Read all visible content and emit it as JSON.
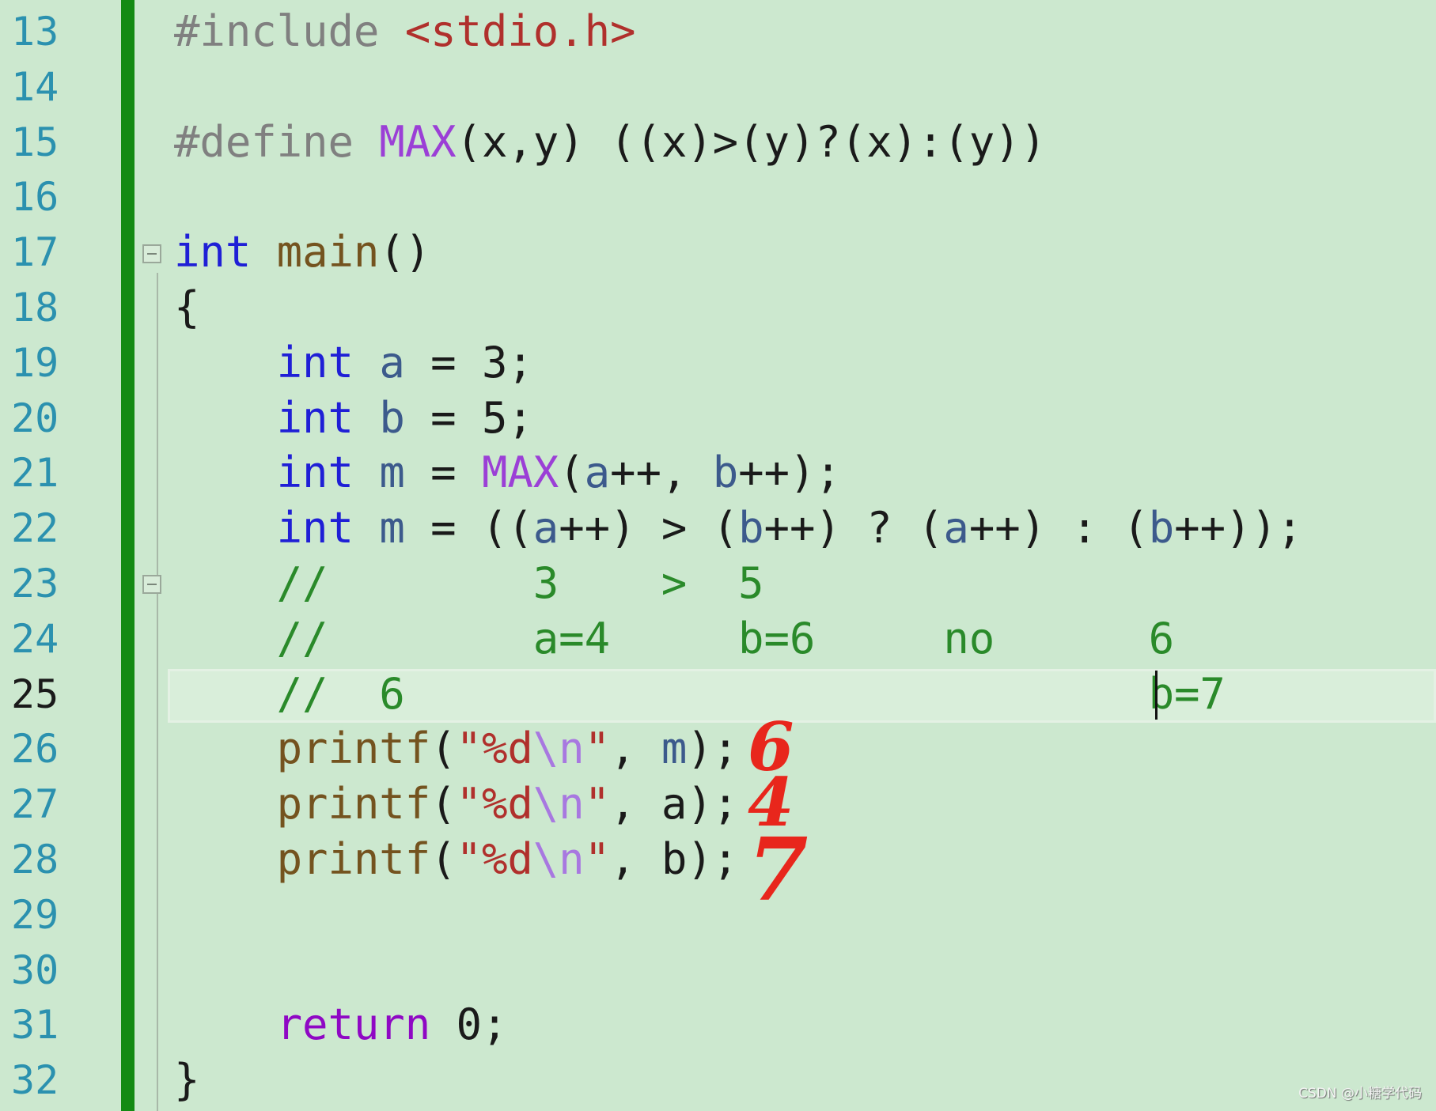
{
  "editor": {
    "current_line": 25,
    "colors": {
      "background": "#cce8cf",
      "line_numbers": "#2b91af",
      "change_bar": "#138a13",
      "keyword": "#1f1fd6",
      "comment": "#2a8a2a",
      "string": "#b0302c",
      "macro": "#9b3fd6"
    },
    "lines": [
      {
        "n": "13",
        "tokens": [
          {
            "t": "#include ",
            "c": "pp"
          },
          {
            "t": "<stdio.h>",
            "c": "str"
          }
        ]
      },
      {
        "n": "14",
        "tokens": []
      },
      {
        "n": "15",
        "tokens": [
          {
            "t": "#define ",
            "c": "pp"
          },
          {
            "t": "MAX",
            "c": "mac"
          },
          {
            "t": "(x,y) ((x)>(y)?(x):(y))",
            "c": "pl"
          }
        ]
      },
      {
        "n": "16",
        "tokens": []
      },
      {
        "n": "17",
        "tokens": [
          {
            "t": "int",
            "c": "kw"
          },
          {
            "t": " ",
            "c": "pl"
          },
          {
            "t": "main",
            "c": "fn"
          },
          {
            "t": "()",
            "c": "pl"
          }
        ]
      },
      {
        "n": "18",
        "tokens": [
          {
            "t": "{",
            "c": "pl"
          }
        ]
      },
      {
        "n": "19",
        "tokens": [
          {
            "t": "    int",
            "c": "kw"
          },
          {
            "t": " ",
            "c": "pl"
          },
          {
            "t": "a",
            "c": "var"
          },
          {
            "t": " = 3;",
            "c": "pl"
          }
        ]
      },
      {
        "n": "20",
        "tokens": [
          {
            "t": "    int",
            "c": "kw"
          },
          {
            "t": " ",
            "c": "pl"
          },
          {
            "t": "b",
            "c": "var"
          },
          {
            "t": " = 5;",
            "c": "pl"
          }
        ]
      },
      {
        "n": "21",
        "tokens": [
          {
            "t": "    int",
            "c": "kw"
          },
          {
            "t": " ",
            "c": "pl"
          },
          {
            "t": "m",
            "c": "var"
          },
          {
            "t": " = ",
            "c": "pl"
          },
          {
            "t": "MAX",
            "c": "mac"
          },
          {
            "t": "(",
            "c": "pl"
          },
          {
            "t": "a",
            "c": "var"
          },
          {
            "t": "++, ",
            "c": "pl"
          },
          {
            "t": "b",
            "c": "var"
          },
          {
            "t": "++);",
            "c": "pl"
          }
        ]
      },
      {
        "n": "22",
        "tokens": [
          {
            "t": "    int",
            "c": "kw"
          },
          {
            "t": " ",
            "c": "pl"
          },
          {
            "t": "m",
            "c": "var"
          },
          {
            "t": " = ((",
            "c": "pl"
          },
          {
            "t": "a",
            "c": "var"
          },
          {
            "t": "++) > (",
            "c": "pl"
          },
          {
            "t": "b",
            "c": "var"
          },
          {
            "t": "++) ? (",
            "c": "pl"
          },
          {
            "t": "a",
            "c": "var"
          },
          {
            "t": "++) : (",
            "c": "pl"
          },
          {
            "t": "b",
            "c": "var"
          },
          {
            "t": "++));",
            "c": "pl"
          }
        ]
      },
      {
        "n": "23",
        "tokens": [
          {
            "t": "    //        3    >  5",
            "c": "cm"
          }
        ]
      },
      {
        "n": "24",
        "tokens": [
          {
            "t": "    //        a=4     b=6     no      6",
            "c": "cm"
          }
        ]
      },
      {
        "n": "25",
        "tokens": [
          {
            "t": "    //  6                             b=7",
            "c": "cm"
          }
        ]
      },
      {
        "n": "26",
        "tokens": [
          {
            "t": "    printf",
            "c": "fn"
          },
          {
            "t": "(",
            "c": "pl"
          },
          {
            "t": "\"%d",
            "c": "str"
          },
          {
            "t": "\\n",
            "c": "esc"
          },
          {
            "t": "\"",
            "c": "str"
          },
          {
            "t": ", ",
            "c": "pl"
          },
          {
            "t": "m",
            "c": "var"
          },
          {
            "t": ");",
            "c": "pl"
          }
        ]
      },
      {
        "n": "27",
        "tokens": [
          {
            "t": "    printf",
            "c": "fn"
          },
          {
            "t": "(",
            "c": "pl"
          },
          {
            "t": "\"%d",
            "c": "str"
          },
          {
            "t": "\\n",
            "c": "esc"
          },
          {
            "t": "\"",
            "c": "str"
          },
          {
            "t": ", a);",
            "c": "pl"
          }
        ]
      },
      {
        "n": "28",
        "tokens": [
          {
            "t": "    printf",
            "c": "fn"
          },
          {
            "t": "(",
            "c": "pl"
          },
          {
            "t": "\"%d",
            "c": "str"
          },
          {
            "t": "\\n",
            "c": "esc"
          },
          {
            "t": "\"",
            "c": "str"
          },
          {
            "t": ", b);",
            "c": "pl"
          }
        ]
      },
      {
        "n": "29",
        "tokens": []
      },
      {
        "n": "30",
        "tokens": []
      },
      {
        "n": "31",
        "tokens": [
          {
            "t": "    return",
            "c": "ret"
          },
          {
            "t": " 0;",
            "c": "pl"
          }
        ]
      },
      {
        "n": "32",
        "tokens": [
          {
            "t": "}",
            "c": "pl"
          }
        ]
      }
    ]
  },
  "annotations": {
    "handwritten": [
      "6",
      "4",
      "7"
    ],
    "color": "#e8261c"
  },
  "watermark": "CSDN @小糖学代码"
}
